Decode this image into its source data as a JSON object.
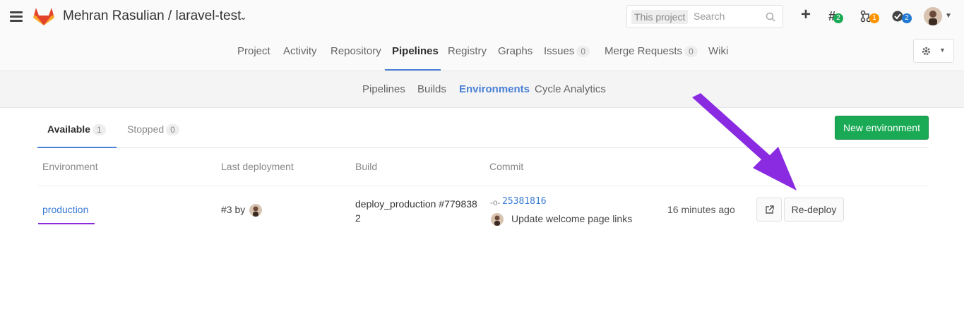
{
  "header": {
    "title": "Mehran Rasulian / laravel-test",
    "search_scope": "This project",
    "search_placeholder": "Search",
    "todos_count": "2",
    "merge_requests_count": "1",
    "issues_count": "2"
  },
  "project_nav": {
    "items": [
      {
        "label": "Project"
      },
      {
        "label": "Activity"
      },
      {
        "label": "Repository"
      },
      {
        "label": "Pipelines"
      },
      {
        "label": "Registry"
      },
      {
        "label": "Graphs"
      },
      {
        "label": "Issues",
        "count": "0"
      },
      {
        "label": "Merge Requests",
        "count": "0"
      },
      {
        "label": "Wiki"
      }
    ]
  },
  "sub_nav": {
    "items": [
      {
        "label": "Pipelines"
      },
      {
        "label": "Builds"
      },
      {
        "label": "Environments"
      },
      {
        "label": "Cycle Analytics"
      }
    ]
  },
  "tabs": {
    "available": {
      "label": "Available",
      "count": "1"
    },
    "stopped": {
      "label": "Stopped",
      "count": "0"
    }
  },
  "new_environment_label": "New environment",
  "table": {
    "headers": {
      "environment": "Environment",
      "last_deployment": "Last deployment",
      "build": "Build",
      "commit": "Commit"
    },
    "rows": [
      {
        "environment": "production",
        "last_deployment": "#3 by",
        "build": "deploy_production #7798382",
        "commit_sha": "25381816",
        "commit_message": "Update welcome page links",
        "time_ago": "16 minutes ago",
        "redeploy_label": "Re-deploy"
      }
    ]
  },
  "colors": {
    "accent": "#4a80d6",
    "success": "#1aaa55",
    "annotation": "#8a2be2"
  }
}
